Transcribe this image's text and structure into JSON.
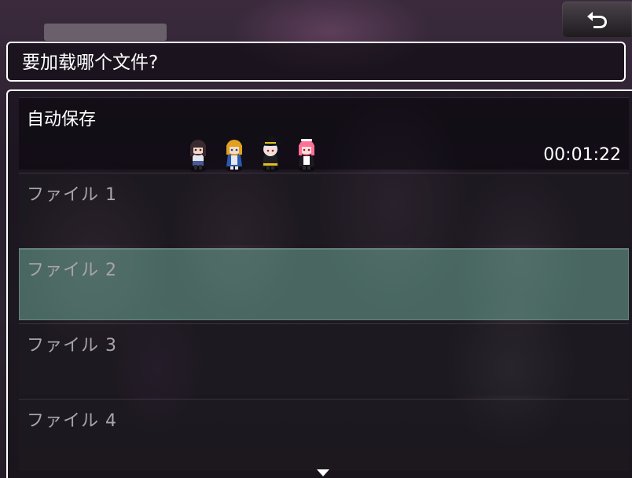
{
  "header": {
    "back_icon": "return-arrow-icon",
    "prompt": "要加载哪个文件?"
  },
  "save_list": {
    "autosave": {
      "title": "自动保存",
      "playtime": "00:01:22",
      "party": [
        {
          "icon": "dark-haired-schoolgirl-sprite",
          "hair": "#3a2a30",
          "outfit": "#e6e6ee",
          "accent": "#4a5a9a"
        },
        {
          "icon": "blonde-blue-dress-sprite",
          "hair": "#e0a020",
          "outfit": "#2c5ab0",
          "accent": "#e8e8f0"
        },
        {
          "icon": "silver-hair-witch-hat-sprite",
          "hair": "#e4e4ea",
          "outfit": "#1e1e22",
          "accent": "#e0c020"
        },
        {
          "icon": "pink-hair-maid-sprite",
          "hair": "#ff7098",
          "outfit": "#1e1a22",
          "accent": "#ffffff"
        }
      ]
    },
    "slots": [
      {
        "title": "ファイル 1",
        "selected": false
      },
      {
        "title": "ファイル 2",
        "selected": true
      },
      {
        "title": "ファイル 3",
        "selected": false
      },
      {
        "title": "ファイル 4",
        "selected": false
      }
    ],
    "scroll_indicator_icon": "scroll-down-arrow-icon"
  },
  "colors": {
    "window_border": "#ffffff",
    "selected_slot": "#6eaa96",
    "empty_label": "#a8a4aa"
  }
}
